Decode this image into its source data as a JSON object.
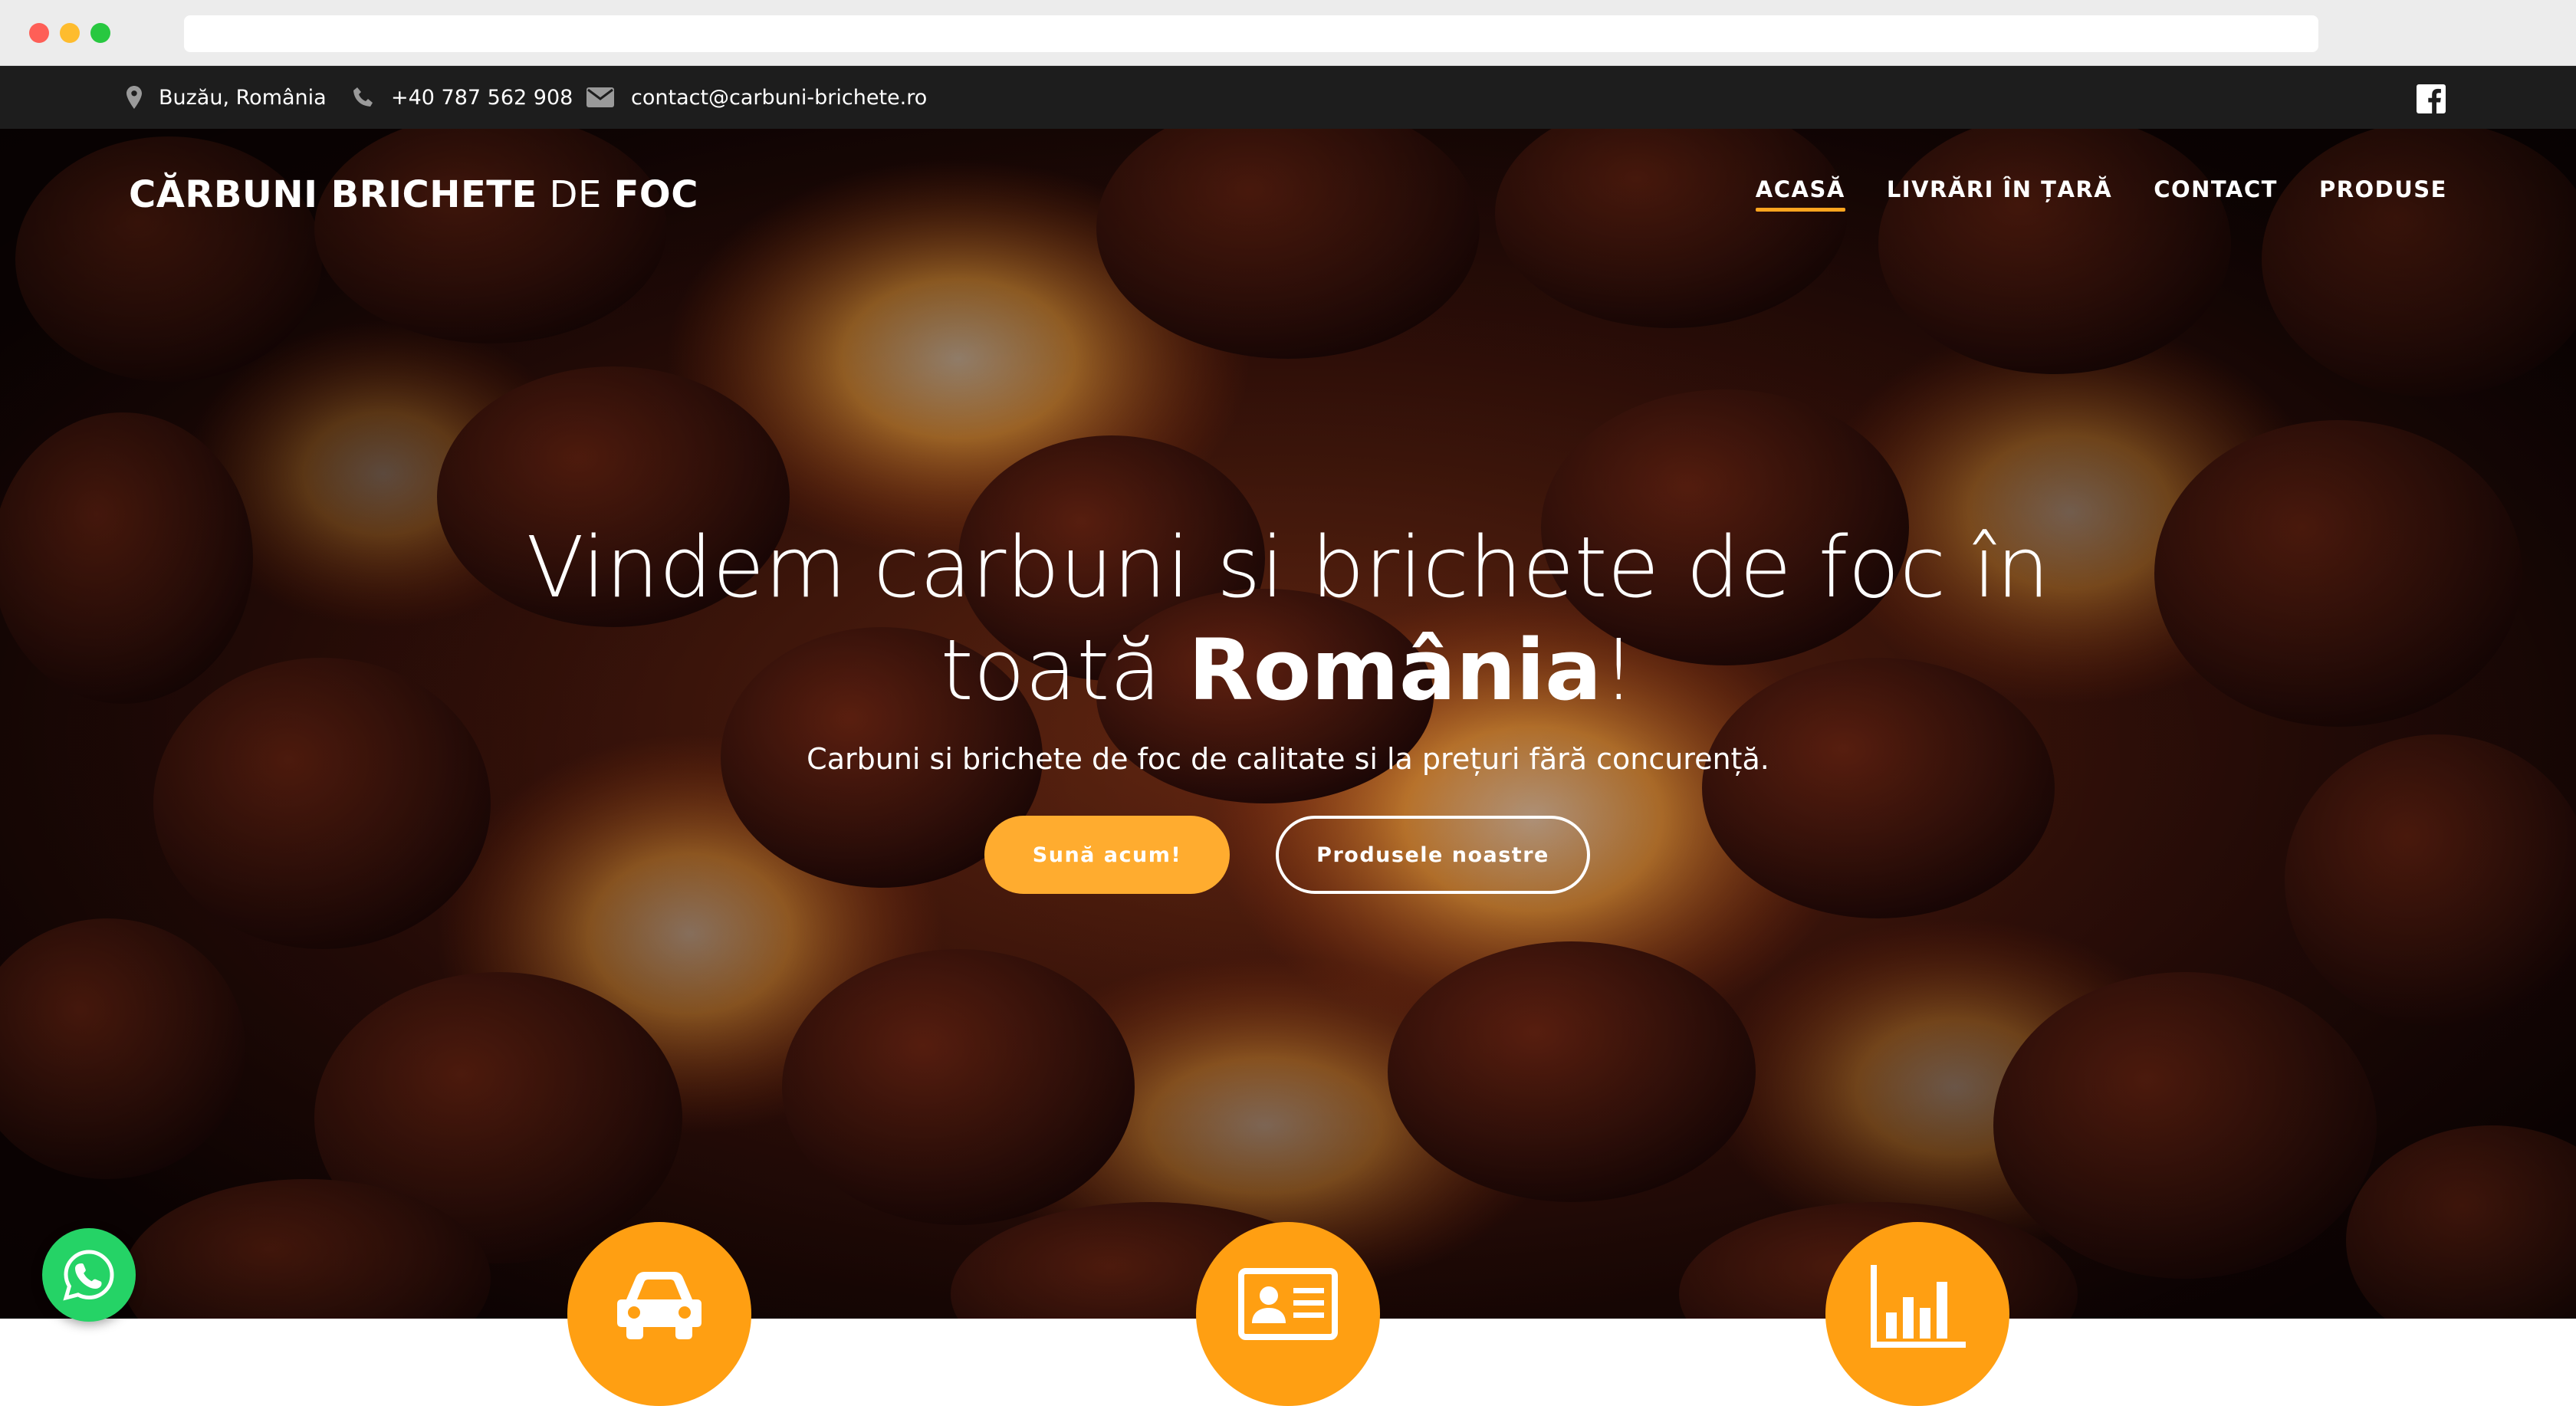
{
  "topbar": {
    "location": "Buzău, România",
    "phone": "+40 787 562 908",
    "email": "contact@carbuni-brichete.ro"
  },
  "brand": {
    "part1": "CĂRBUNI BRICHETE",
    "part2": "DE",
    "part3": "FOC"
  },
  "nav": {
    "items": [
      {
        "label": "ACASĂ"
      },
      {
        "label": "LIVRĂRI ÎN ȚARĂ"
      },
      {
        "label": "CONTACT"
      },
      {
        "label": "PRODUSE"
      }
    ]
  },
  "hero": {
    "headline_line1": "Vindem carbuni si brichete de foc în",
    "headline_line2_pre": "toată",
    "headline_line2_bold": "România",
    "headline_line2_post": "!",
    "subtitle": "Carbuni si brichete de foc de calitate si la prețuri fără concurență.",
    "cta_primary": "Sună acum!",
    "cta_secondary": "Produsele noastre"
  },
  "features": [
    {
      "icon": "car-icon"
    },
    {
      "icon": "id-card-icon"
    },
    {
      "icon": "bar-chart-icon"
    }
  ],
  "colors": {
    "accent": "#ffa51f",
    "topbar_bg": "#1d1d1d",
    "whatsapp": "#25d366"
  }
}
